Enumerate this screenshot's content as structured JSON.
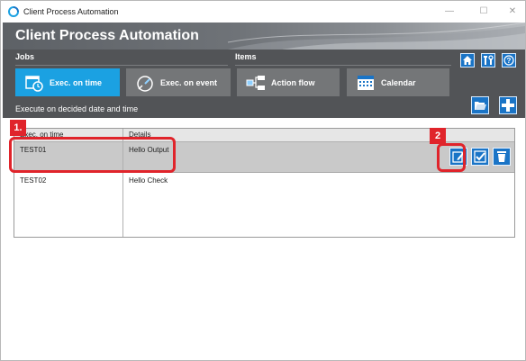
{
  "window": {
    "title": "Client Process Automation",
    "controls": [
      "—",
      "☐",
      "✕"
    ]
  },
  "banner": {
    "title": "Client Process Automation"
  },
  "toolbar": {
    "jobs_label": "Jobs",
    "items_label": "Items",
    "buttons": [
      {
        "label": "Exec. on time",
        "icon": "calendar-clock-icon",
        "active": true
      },
      {
        "label": "Exec. on event",
        "icon": "event-gauge-icon",
        "active": false
      },
      {
        "label": "Action flow",
        "icon": "action-flow-icon",
        "active": false
      },
      {
        "label": "Calendar",
        "icon": "calendar-icon",
        "active": false
      }
    ],
    "top_right_icons": [
      "home-icon",
      "tools-icon",
      "help-icon"
    ],
    "description": "Execute on decided date and time",
    "bottom_right_icons": [
      "open-folder-icon",
      "add-icon"
    ]
  },
  "table": {
    "columns": [
      "Exec. on time",
      "Details"
    ],
    "rows": [
      {
        "name": "TEST01",
        "details": "Hello Output",
        "selected": true
      },
      {
        "name": "TEST02",
        "details": "Hello Check",
        "selected": false
      }
    ],
    "row_action_icons": [
      "edit-icon",
      "check-icon",
      "delete-icon"
    ]
  },
  "callouts": [
    "1.",
    "2"
  ],
  "colors": {
    "accent": "#1ba1e2",
    "toolbar_bg": "#525457",
    "button_bg": "#747678",
    "icon_blue": "#1a74c6",
    "callout_red": "#e0242b",
    "selected_row": "#c9c9c9"
  }
}
